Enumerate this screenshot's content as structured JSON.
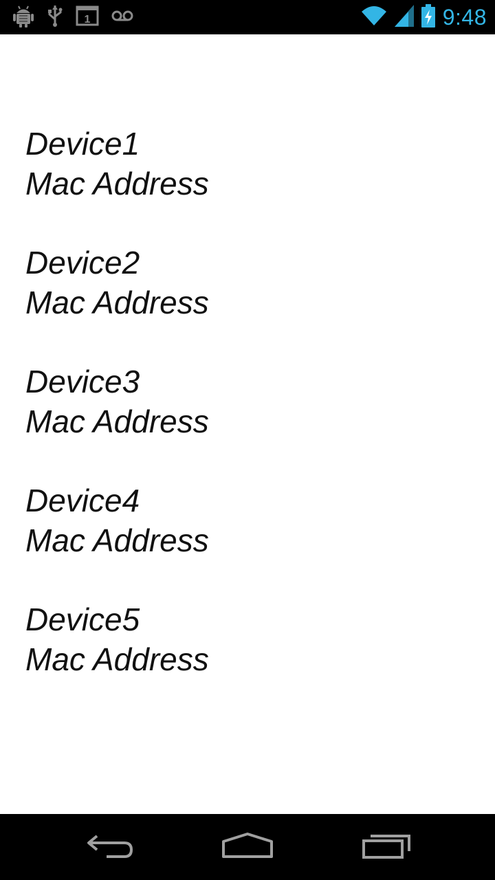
{
  "status_bar": {
    "time": "9:48",
    "time_color": "#33b5e5",
    "left_icons": [
      "android-debug-icon",
      "usb-icon",
      "calendar-icon",
      "voicemail-icon"
    ],
    "right_icons": [
      "wifi-icon",
      "signal-icon",
      "battery-charging-icon"
    ]
  },
  "devices": [
    {
      "name": "Device1",
      "mac": "Mac Address"
    },
    {
      "name": "Device2",
      "mac": "Mac Address"
    },
    {
      "name": "Device3",
      "mac": "Mac Address"
    },
    {
      "name": "Device4",
      "mac": "Mac Address"
    },
    {
      "name": "Device5",
      "mac": "Mac Address"
    }
  ],
  "calendar_day": "1",
  "nav_bar": {
    "buttons": [
      "back-button",
      "home-button",
      "recent-apps-button"
    ]
  }
}
